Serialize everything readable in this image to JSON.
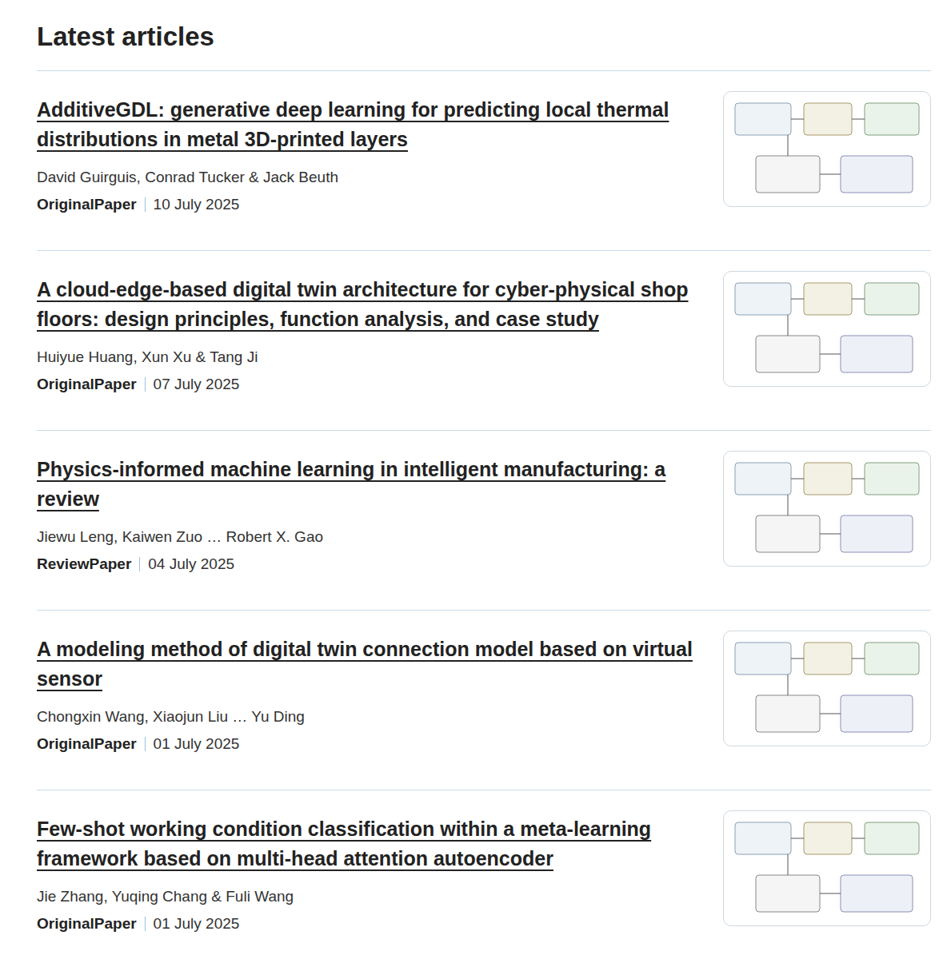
{
  "heading": "Latest articles",
  "articles": [
    {
      "title": "AdditiveGDL: generative deep learning for predicting local thermal distributions in metal 3D-printed layers",
      "authors": "David Guirguis, Conrad Tucker & Jack Beuth",
      "type": "OriginalPaper",
      "date": "10 July 2025"
    },
    {
      "title": "A cloud-edge-based digital twin architecture for cyber-physical shop floors: design principles, function analysis, and case study",
      "authors": "Huiyue Huang, Xun Xu & Tang Ji",
      "type": "OriginalPaper",
      "date": "07 July 2025"
    },
    {
      "title": "Physics-informed machine learning in intelligent manufacturing: a review",
      "authors": "Jiewu Leng, Kaiwen Zuo … Robert X. Gao",
      "type": "ReviewPaper",
      "date": "04 July 2025"
    },
    {
      "title": "A modeling method of digital twin connection model based on virtual sensor",
      "authors": "Chongxin Wang, Xiaojun Liu … Yu Ding",
      "type": "OriginalPaper",
      "date": "01 July 2025"
    },
    {
      "title": "Few-shot working condition classification within a meta-learning framework based on multi-head attention autoencoder",
      "authors": "Jie Zhang, Yuqing Chang & Fuli Wang",
      "type": "OriginalPaper",
      "date": "01 July 2025"
    }
  ]
}
